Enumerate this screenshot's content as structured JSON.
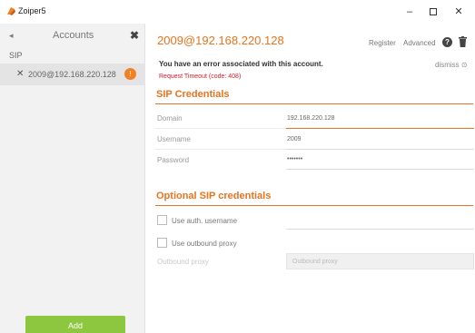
{
  "window": {
    "title": "Zoiper5",
    "minimize": "–",
    "close": "✕"
  },
  "sidebar": {
    "back_icon": "◂",
    "title": "Accounts",
    "close": "✖",
    "section": "SIP",
    "accounts": [
      {
        "name": "2009@192.168.220.128",
        "remove": "✕",
        "badge": "!"
      }
    ],
    "add_label": "Add"
  },
  "main": {
    "account_title": "2009@192.168.220.128",
    "register_label": "Register",
    "advanced_label": "Advanced",
    "help": "?",
    "error_message": "You have an error associated with this account.",
    "error_detail": "Request Timeout (code: 408)",
    "dismiss_label": "dismiss ⊙",
    "sip_credentials": {
      "title": "SIP Credentials",
      "domain_label": "Domain",
      "domain_value": "192.168.220.128",
      "username_label": "Username",
      "username_value": "2009",
      "password_label": "Password",
      "password_value": "•••••••"
    },
    "optional": {
      "title": "Optional SIP credentials",
      "use_auth_label": "Use auth. username",
      "use_proxy_label": "Use outbound proxy",
      "proxy_label": "Outbound proxy",
      "proxy_placeholder": "Outbound proxy"
    }
  },
  "colors": {
    "accent": "#e8731e",
    "add_button": "#8dc63f",
    "error": "#d0202a",
    "badge": "#f08224"
  },
  "icons": {
    "app": "zoiper-logo-icon",
    "help": "help-icon",
    "delete": "trash-icon"
  }
}
